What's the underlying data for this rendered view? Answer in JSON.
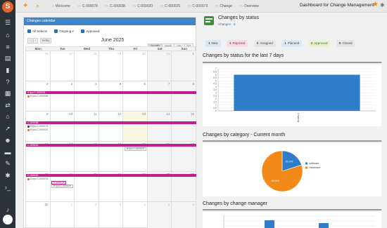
{
  "topbar": {
    "breadcrumbs": [
      {
        "icon": "home-icon",
        "label": "Welcome"
      },
      {
        "icon": "ticket-icon",
        "label": "C-000078"
      },
      {
        "icon": "ticket-icon",
        "label": "C-000038"
      },
      {
        "icon": "ticket-icon",
        "label": "C-000020"
      },
      {
        "icon": "ticket-icon",
        "label": "C-000025"
      },
      {
        "icon": "ticket-icon",
        "label": "C-000073"
      },
      {
        "icon": "ticket-icon",
        "label": "Change"
      },
      {
        "icon": "ticket-icon",
        "label": "Overview"
      }
    ],
    "title": "Dashboard for Change Management"
  },
  "calendar": {
    "header": "Changes calendar",
    "filters": [
      {
        "label": "All Selects"
      },
      {
        "label": "Ongoing"
      },
      {
        "label": "Approved"
      }
    ],
    "nav": {
      "prev": "‹",
      "next": "›",
      "today": "today",
      "title": "June 2025"
    },
    "views": [
      "month",
      "week",
      "day",
      "list"
    ],
    "days_of_week": [
      "Mon",
      "Tue",
      "Wed",
      "Thu",
      "Fri",
      "Sat",
      "Sun"
    ],
    "weeks": [
      [
        "26",
        "27",
        "28",
        "29",
        "30",
        "31",
        "1"
      ],
      [
        "2",
        "3",
        "4",
        "5",
        "6",
        "7",
        "8"
      ],
      [
        "9",
        "10",
        "11",
        "12",
        "13",
        "14",
        "15"
      ],
      [
        "16",
        "17",
        "18",
        "19",
        "20",
        "21",
        "22"
      ],
      [
        "23",
        "24",
        "25",
        "26",
        "27",
        "28",
        "29"
      ],
      [
        "30",
        "1",
        "2",
        "3",
        "4",
        "5",
        "6"
      ]
    ],
    "events": {
      "w1_bar": "9 cpu C-000025",
      "w1_line": "8 cpu C-000038",
      "w2_bar": "C-000038",
      "w2_line1": "8 cpu C-000073",
      "w2_line2": "8 cpu C-000020",
      "w3_bar": "C-000020",
      "w3_box": "8 cpu C-000025",
      "w4_bar": "C-000020",
      "w4_line": "8 cpu C-000078",
      "w4_box1": "C-000078",
      "w4_box2": "8 cpu C-000025"
    }
  },
  "status": {
    "title": "Changes by status",
    "subtitle": "Changes - 5",
    "chips": [
      {
        "count": "1",
        "label": "New"
      },
      {
        "count": "1",
        "label": "Rejected"
      },
      {
        "count": "0",
        "label": "Assigned"
      },
      {
        "count": "1",
        "label": "Planned"
      },
      {
        "count": "2",
        "label": "Approved"
      },
      {
        "count": "0",
        "label": "Closed"
      }
    ]
  },
  "sections": {
    "last7": "Changes by status for the last 7 days",
    "category": "Changes by category - Current month",
    "manager": "Changes by change manager"
  },
  "chart_data": [
    {
      "type": "bar",
      "categories": [
        "Ongoing"
      ],
      "values": [
        6
      ],
      "title": "",
      "xlabel": "",
      "ylabel": "",
      "ylim": [
        0,
        7
      ],
      "yticks": [
        "0",
        "0.5",
        "1",
        "1.5",
        "2",
        "2.5",
        "3",
        "3.5",
        "4",
        "4.5",
        "5",
        "5.5",
        "6",
        "6.5",
        "7"
      ],
      "color": "#2f7dc8"
    },
    {
      "type": "pie",
      "categories": [
        "software",
        "Hardware"
      ],
      "values": [
        20.0,
        80.0
      ],
      "labels": [
        "20.0%",
        "80.0%"
      ],
      "colors": [
        "#2f7dc8",
        "#f28a1a"
      ],
      "legend": "right"
    }
  ],
  "colors": {
    "sidebar": "#2d3238",
    "accent": "#f08a00",
    "calendar_header": "#3d85c6",
    "event": "#c0208f"
  }
}
